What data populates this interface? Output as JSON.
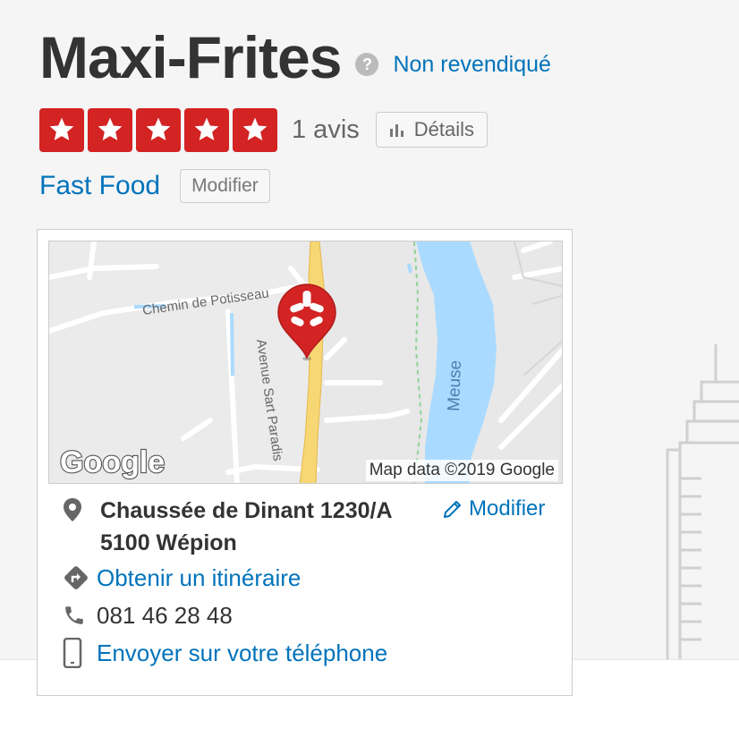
{
  "business": {
    "name": "Maxi-Frites",
    "help_symbol": "?",
    "claim_status": "Non revendiqué",
    "rating": 5,
    "max_rating": 5,
    "review_count": "1 avis",
    "details_label": "Détails",
    "category": "Fast Food",
    "modify_category_label": "Modifier"
  },
  "map": {
    "street_1": "Chemin de Potisseau",
    "street_2": "Avenue Sart Paradis",
    "river": "Meuse",
    "logo": "Google",
    "attribution": "Map data ©2019 Google",
    "marker_icon": "yelp-burst-icon"
  },
  "info": {
    "address_line1": "Chaussée de Dinant 1230/A",
    "address_line2": "5100 Wépion",
    "modify_address_label": "Modifier",
    "directions_label": "Obtenir un itinéraire",
    "phone": "081 46 28 48",
    "send_to_phone_label": "Envoyer sur votre téléphone"
  },
  "colors": {
    "star_red": "#d32323",
    "link_blue": "#0073bb",
    "road_yellow": "#f7d774",
    "river_blue": "#aadaff"
  }
}
